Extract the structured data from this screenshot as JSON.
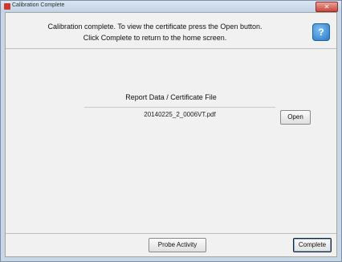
{
  "window": {
    "title": "Calibration Complete",
    "close_label": "✕"
  },
  "header": {
    "message_line1": "Calibration complete. To view the certificate press the Open button.",
    "message_line2": "Click Complete to return to the home screen.",
    "help_label": "?"
  },
  "report": {
    "label": "Report Data / Certificate File",
    "filename": "20140225_2_0006VT.pdf",
    "open_label": "Open"
  },
  "footer": {
    "probe_activity_label": "Probe Activity",
    "complete_label": "Complete"
  },
  "icons": {
    "help": "help-icon",
    "app": "app-icon",
    "close": "close-icon"
  },
  "colors": {
    "help_blue": "#2a78c8",
    "close_red": "#c9473c",
    "window_frame": "#c9d6e6"
  }
}
